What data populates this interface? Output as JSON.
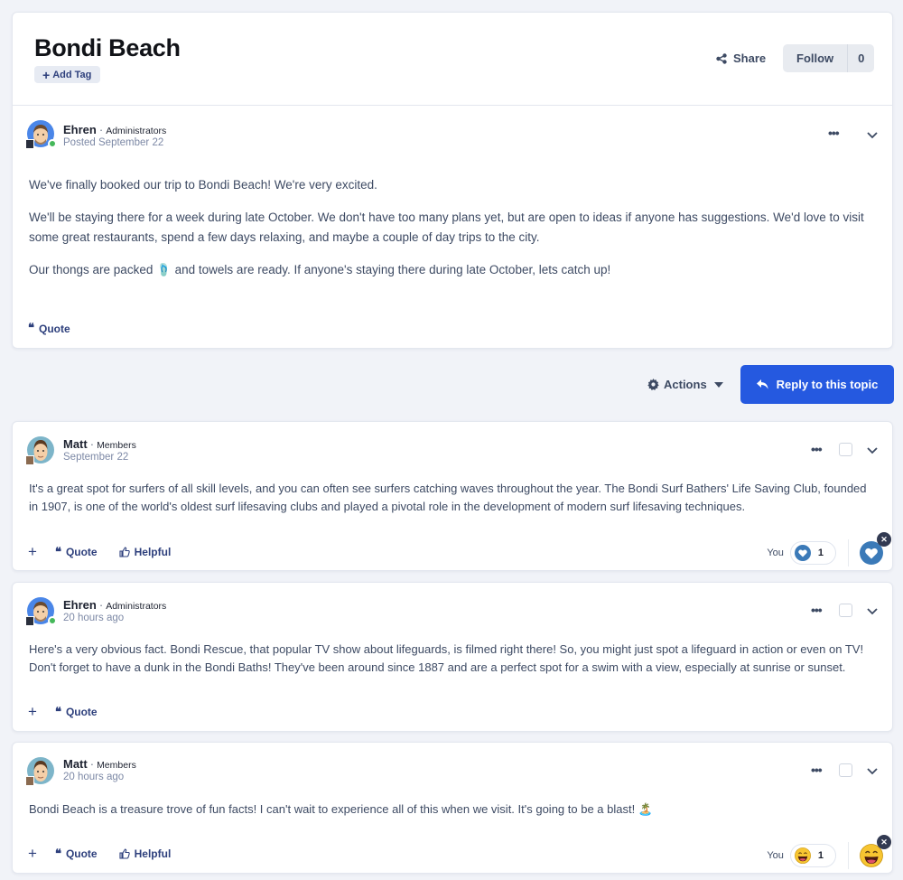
{
  "topic": {
    "title": "Bondi Beach",
    "add_tag_label": "Add Tag",
    "share_label": "Share",
    "follow_label": "Follow",
    "follow_count": "0"
  },
  "original_post": {
    "author": "Ehren",
    "group": "Administrators",
    "date": "Posted September 22",
    "online": true,
    "paragraphs": [
      "We've finally booked our trip to Bondi Beach! We're very excited.",
      "We'll be staying there for a week during late October. We don't have too many plans yet, but are open to ideas if anyone has suggestions. We'd love to visit some great restaurants, spend a few days relaxing, and maybe a couple of day trips to the city.",
      "Our thongs are packed 🩴 and towels are ready. If anyone's staying there during late October, lets catch up!"
    ],
    "quote_label": "Quote"
  },
  "toolbar": {
    "actions_label": "Actions",
    "reply_label": "Reply to this topic"
  },
  "replies": [
    {
      "author": "Matt",
      "group": "Members",
      "date": "September 22",
      "text": "It's a great spot for surfers of all skill levels, and you can often see surfers catching waves throughout the year. The Bondi Surf Bathers' Life Saving Club, founded in 1907, is one of the world's oldest surf lifesaving clubs and played a pivotal role in the development of modern surf lifesaving techniques.",
      "quote_label": "Quote",
      "helpful_label": "Helpful",
      "reaction": {
        "who": "You",
        "type": "heart",
        "count": "1"
      }
    },
    {
      "author": "Ehren",
      "group": "Administrators",
      "date": "20 hours ago",
      "text": "Here's a very obvious fact. Bondi Rescue, that popular TV show about lifeguards, is filmed right there! So, you might just spot a lifeguard in action or even on TV! Don't forget to have a dunk in the Bondi Baths! They've been around since 1887 and are a perfect spot for a swim with a view, especially at sunrise or sunset.",
      "quote_label": "Quote"
    },
    {
      "author": "Matt",
      "group": "Members",
      "date": "20 hours ago",
      "text": "Bondi Beach is a treasure trove of fun facts! I can't wait to experience all of this when we visit. It's going to be a blast! 🏝️",
      "quote_label": "Quote",
      "helpful_label": "Helpful",
      "reaction": {
        "who": "You",
        "type": "laugh",
        "count": "1"
      }
    }
  ],
  "colors": {
    "accent": "#2559e0",
    "link": "#2d3f7c",
    "heart": "#3b7ab8",
    "online": "#45b85a"
  }
}
